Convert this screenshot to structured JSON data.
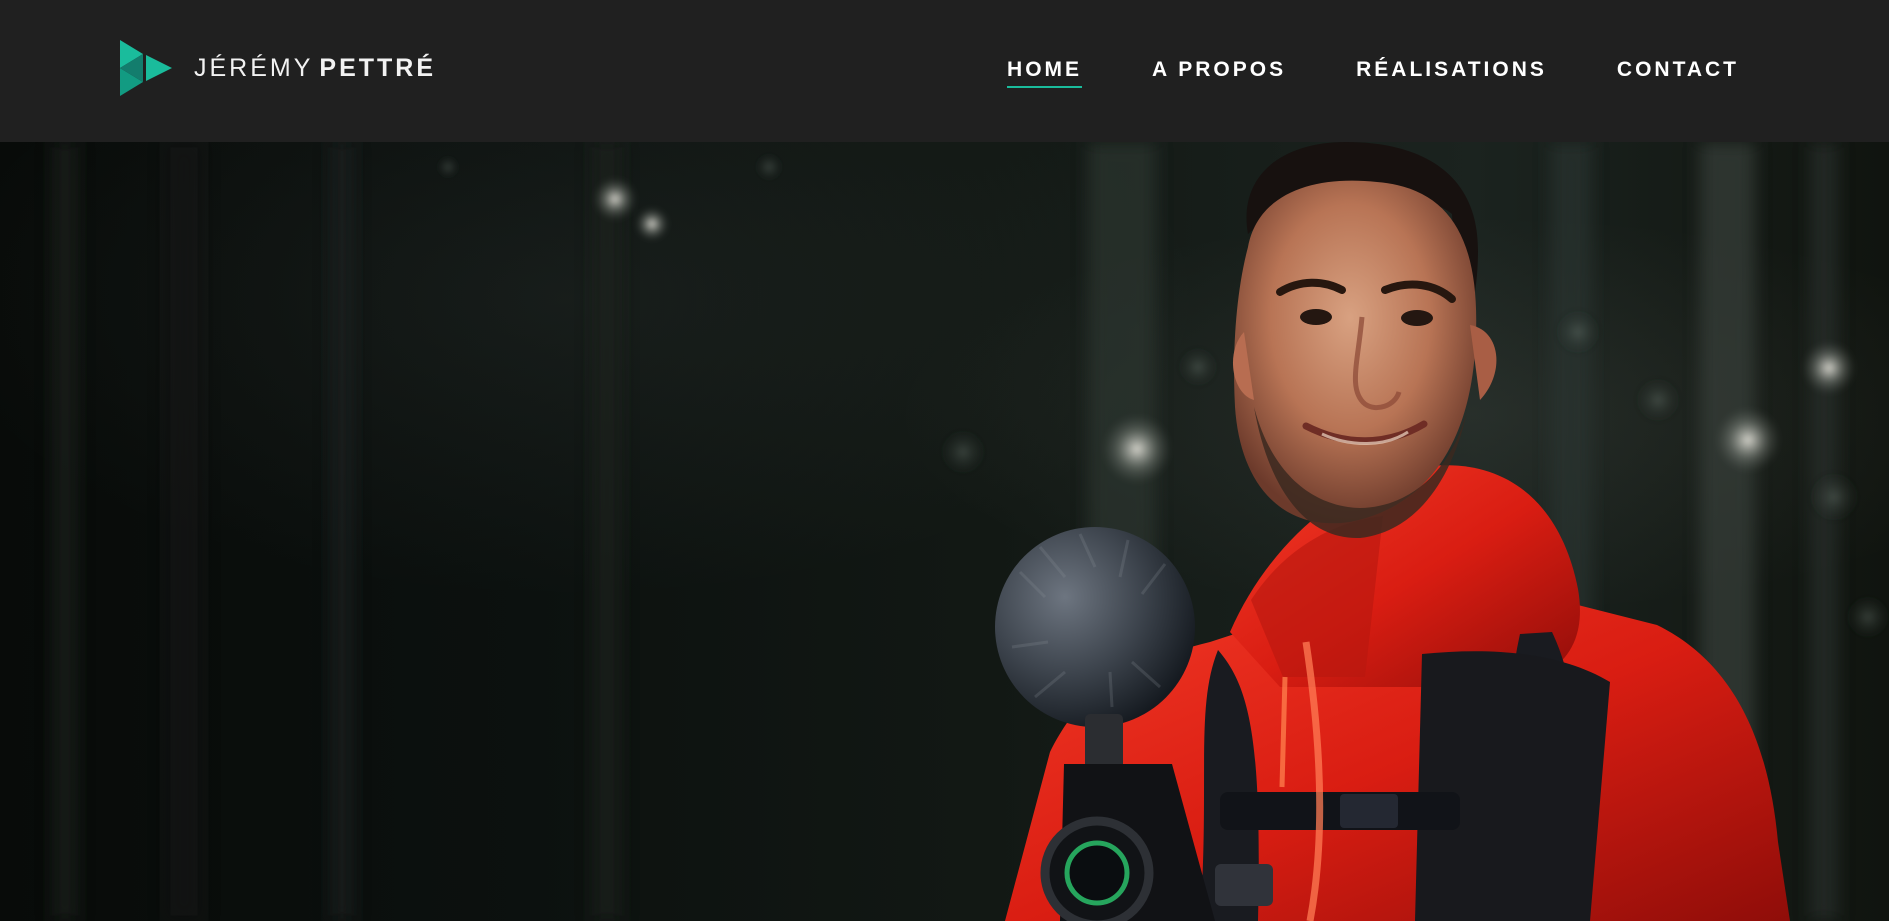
{
  "brand": {
    "first_name": "JÉRÉMY",
    "last_name": "PETTRÉ",
    "logo_icon": "play-triangles-logo",
    "accent_color": "#1abc9c"
  },
  "navigation": {
    "items": [
      {
        "label": "HOME",
        "active": true
      },
      {
        "label": "A PROPOS",
        "active": false
      },
      {
        "label": "RÉALISATIONS",
        "active": false
      },
      {
        "label": "CONTACT",
        "active": false
      }
    ]
  },
  "hero": {
    "image_subject": "smiling man in red jacket holding camera with microphone in dark forest",
    "jacket_color": "#d92016",
    "background_color": "#0b0f0d"
  }
}
